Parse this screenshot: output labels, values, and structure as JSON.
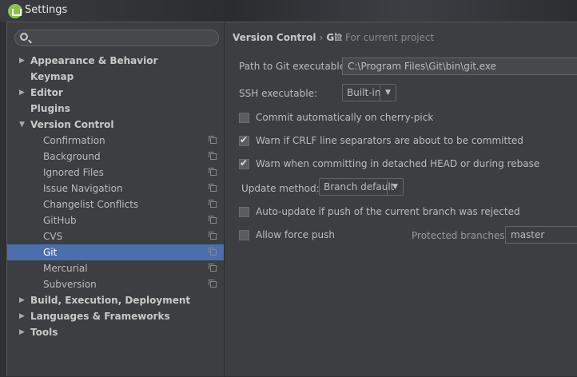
{
  "window": {
    "title": "Settings"
  },
  "search": {
    "placeholder": ""
  },
  "tree": [
    {
      "label": "Appearance & Behavior",
      "level": 0,
      "arrow": "▶"
    },
    {
      "label": "Keymap",
      "level": 0
    },
    {
      "label": "Editor",
      "level": 0,
      "arrow": "▶"
    },
    {
      "label": "Plugins",
      "level": 0
    },
    {
      "label": "Version Control",
      "level": 0,
      "arrow": "▼"
    },
    {
      "label": "Confirmation",
      "level": 1
    },
    {
      "label": "Background",
      "level": 1
    },
    {
      "label": "Ignored Files",
      "level": 1
    },
    {
      "label": "Issue Navigation",
      "level": 1
    },
    {
      "label": "Changelist Conflicts",
      "level": 1
    },
    {
      "label": "GitHub",
      "level": 1
    },
    {
      "label": "CVS",
      "level": 1
    },
    {
      "label": "Git",
      "level": 1,
      "selected": true
    },
    {
      "label": "Mercurial",
      "level": 1
    },
    {
      "label": "Subversion",
      "level": 1
    },
    {
      "label": "Build, Execution, Deployment",
      "level": 0,
      "arrow": "▶"
    },
    {
      "label": "Languages & Frameworks",
      "level": 0,
      "arrow": "▶"
    },
    {
      "label": "Tools",
      "level": 0,
      "arrow": "▶"
    }
  ],
  "breadcrumb": {
    "parent": "Version Control",
    "sep": "›",
    "current": "Git",
    "scope": "For current project"
  },
  "form": {
    "git_path_label": "Path to Git executable:",
    "git_path_value": "C:\\Program Files\\Git\\bin\\git.exe",
    "ssh_label": "SSH executable:",
    "ssh_value": "Built-in",
    "cherry_pick": {
      "label": "Commit automatically on cherry-pick",
      "checked": false
    },
    "crlf": {
      "label": "Warn if CRLF line separators are about to be committed",
      "checked": true
    },
    "detached": {
      "label": "Warn when committing in detached HEAD or during rebase",
      "checked": true
    },
    "update_label": "Update method:",
    "update_value": "Branch default",
    "auto_update": {
      "label": "Auto-update if push of the current branch was rejected",
      "checked": false
    },
    "force_push": {
      "label": "Allow force push",
      "checked": false
    },
    "protected_label": "Protected branches:",
    "protected_value": "master"
  },
  "colors": {
    "selection": "#4b6eaf",
    "background": "#3c3f41"
  }
}
